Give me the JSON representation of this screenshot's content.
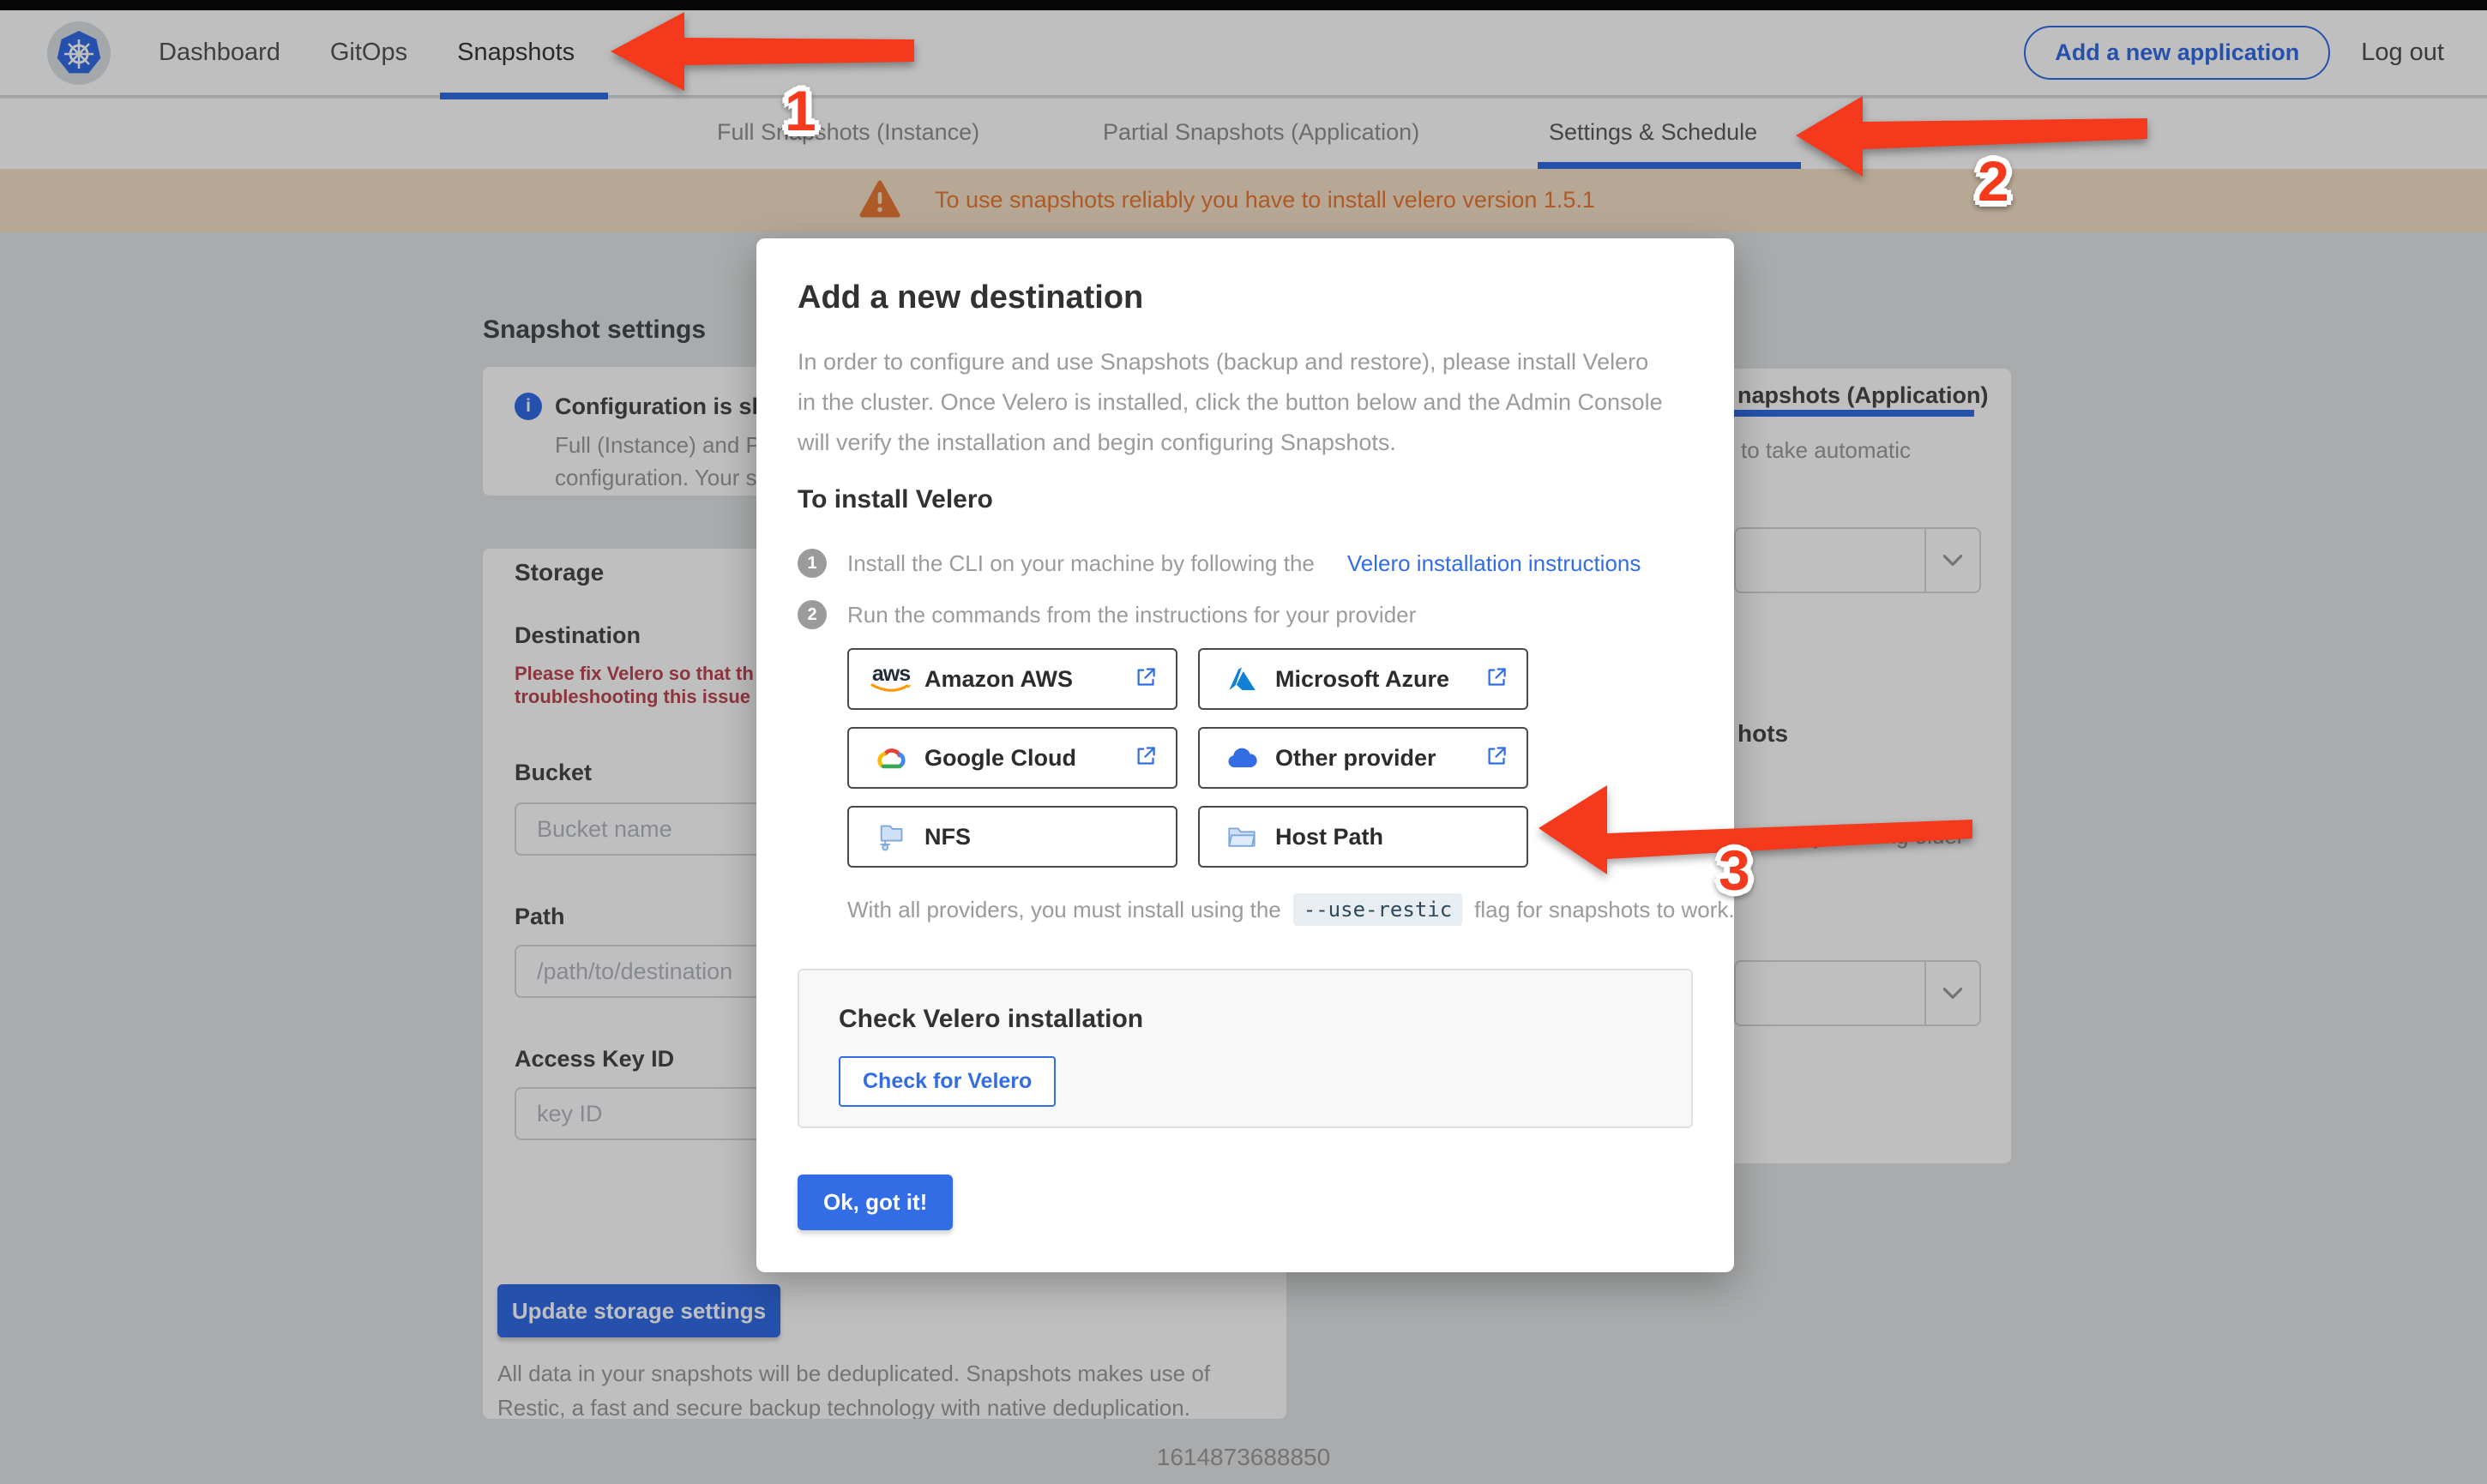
{
  "nav": {
    "items": [
      {
        "label": "Dashboard"
      },
      {
        "label": "GitOps"
      },
      {
        "label": "Snapshots"
      }
    ],
    "active": "Snapshots",
    "add_app_button": "Add a new application",
    "logout_label": "Log out"
  },
  "tabs": [
    {
      "label": "Full Snapshots (Instance)"
    },
    {
      "label": "Partial Snapshots (Application)"
    },
    {
      "label": "Settings & Schedule"
    }
  ],
  "banner": {
    "text": "To use snapshots reliably you have to install velero version 1.5.1"
  },
  "page": {
    "title": "Snapshot settings",
    "info_card": {
      "title_fragment": "Configuration is sh",
      "line1_fragment": "Full (Instance) and Parti",
      "line2_fragment": "configuration. Your stor"
    },
    "storage": {
      "heading": "Storage",
      "destination_label": "Destination",
      "error_line1": "Please fix Velero so that th",
      "error_line2": "troubleshooting this issue",
      "bucket_label": "Bucket",
      "bucket_placeholder": "Bucket name",
      "path_label": "Path",
      "path_placeholder": "/path/to/destination",
      "access_key_label": "Access Key ID",
      "access_key_placeholder": "key ID",
      "update_button": "Update storage settings",
      "dedup_line1": "All data in your snapshots will be deduplicated. Snapshots makes use of",
      "dedup_line2": "Restic, a fast and secure backup technology with native deduplication."
    },
    "right_panel": {
      "tab_fragment": "napshots (Application)",
      "auto_fragment": "to take automatic",
      "heading_fragment": "hots",
      "deleting_fragment": "matically deleting older"
    }
  },
  "modal": {
    "title": "Add a new destination",
    "paragraph": "In order to configure and use Snapshots (backup and restore), please install Velero in the cluster. Once Velero is installed, click the button below and the Admin Console will verify the installation and begin configuring Snapshots.",
    "install_heading": "To install Velero",
    "step1_number": "1",
    "step1_text": "Install the CLI on your machine by following the",
    "step1_link": "Velero installation instructions",
    "step2_number": "2",
    "step2_text": "Run the commands from the instructions for your provider",
    "providers": [
      {
        "label": "Amazon AWS",
        "icon": "aws-logo",
        "external": true
      },
      {
        "label": "Microsoft Azure",
        "icon": "azure-logo",
        "external": true
      },
      {
        "label": "Google Cloud",
        "icon": "google-cloud-logo",
        "external": true
      },
      {
        "label": "Other provider",
        "icon": "cloud-icon",
        "external": true
      },
      {
        "label": "NFS",
        "icon": "nfs-icon",
        "external": false
      },
      {
        "label": "Host Path",
        "icon": "folder-icon",
        "external": false
      }
    ],
    "restic_pre": "With all providers, you must install using the",
    "restic_code": "--use-restic",
    "restic_post": "flag for snapshots to work.",
    "check_heading": "Check Velero installation",
    "check_button": "Check for Velero",
    "ok_button": "Ok, got it!"
  },
  "footer": {
    "timestamp": "1614873688850"
  },
  "annotations": {
    "label1": "1",
    "label2": "2",
    "label3": "3"
  },
  "colors": {
    "accent_blue": "#326de6",
    "arrow_red": "#f4391c",
    "banner_bg": "#f4e1c9",
    "banner_text": "#e77835",
    "error_red": "#bc4752",
    "aws_orange": "#ff9900",
    "azure_blue": "#0f82d8"
  }
}
